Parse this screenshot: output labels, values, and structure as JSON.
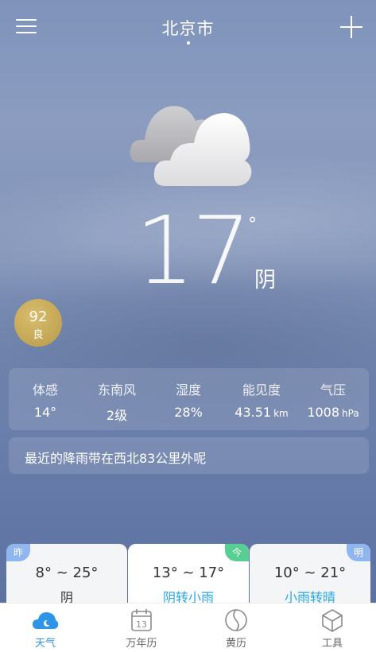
{
  "header": {
    "city": "北京市"
  },
  "current": {
    "temperature": "17",
    "degree_symbol": "°",
    "condition": "阴",
    "icon": "cloudy-icon"
  },
  "aqi": {
    "value": "92",
    "level": "良",
    "color": "#c9ad5e"
  },
  "details": [
    {
      "label": "体感",
      "value": "14°",
      "unit": ""
    },
    {
      "label": "东南风",
      "value": "2级",
      "unit": ""
    },
    {
      "label": "湿度",
      "value": "28%",
      "unit": ""
    },
    {
      "label": "能见度",
      "value": "43.51",
      "unit": "km"
    },
    {
      "label": "气压",
      "value": "1008",
      "unit": "hPa"
    }
  ],
  "notice": "最近的降雨带在西北83公里外呢",
  "forecast": [
    {
      "tag": "昨",
      "range": "8° ~ 25°",
      "desc": "阴"
    },
    {
      "tag": "今",
      "range": "13° ~ 17°",
      "desc": "阴转小雨"
    },
    {
      "tag": "明",
      "range": "10° ~ 21°",
      "desc": "小雨转晴"
    }
  ],
  "tabs": [
    {
      "label": "天气",
      "icon": "weather-icon",
      "active": true
    },
    {
      "label": "万年历",
      "icon": "calendar-icon",
      "calendar_day": "13"
    },
    {
      "label": "黄历",
      "icon": "almanac-icon"
    },
    {
      "label": "工具",
      "icon": "tools-icon"
    }
  ],
  "colors": {
    "accent": "#2f95e8",
    "today_tag": "#58cf92",
    "tag": "#8fb6ee",
    "rain_text": "#2aa7e6"
  }
}
